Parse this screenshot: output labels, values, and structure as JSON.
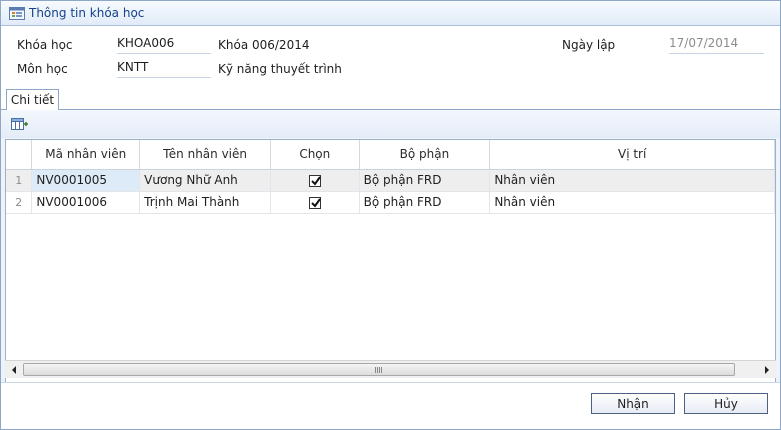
{
  "window": {
    "title": "Thông tin khóa học",
    "icon": "course-info-icon"
  },
  "header": {
    "course_label": "Khóa học",
    "course_code": "KHOA006",
    "course_name": "Khóa 006/2014",
    "subject_label": "Môn học",
    "subject_code": "KNTT",
    "subject_name": "Kỹ năng thuyết trình",
    "date_label": "Ngày lập",
    "date_value": "17/07/2014"
  },
  "tabs": [
    {
      "label": "Chi tiết",
      "active": true
    }
  ],
  "toolbar": {
    "column_chooser_icon": "column-chooser-icon"
  },
  "grid": {
    "columns": [
      "Mã nhân viên",
      "Tên nhân viên",
      "Chọn",
      "Bộ phận",
      "Vị trí"
    ],
    "rows": [
      {
        "num": "1",
        "emp_id": "NV0001005",
        "emp_name": "Vương Nhữ Anh",
        "selected": true,
        "dept": "Bộ phận FRD",
        "position": "Nhân viên"
      },
      {
        "num": "2",
        "emp_id": "NV0001006",
        "emp_name": "Trịnh Mai Thành",
        "selected": true,
        "dept": "Bộ phận FRD",
        "position": "Nhân viên"
      }
    ]
  },
  "footer": {
    "ok_label": "Nhận",
    "cancel_label": "Hủy"
  },
  "colors": {
    "title_text": "#15428b",
    "border": "#8ea6c8",
    "panel_bg": "#eef3fb",
    "selected_cell": "#dcebf7"
  }
}
